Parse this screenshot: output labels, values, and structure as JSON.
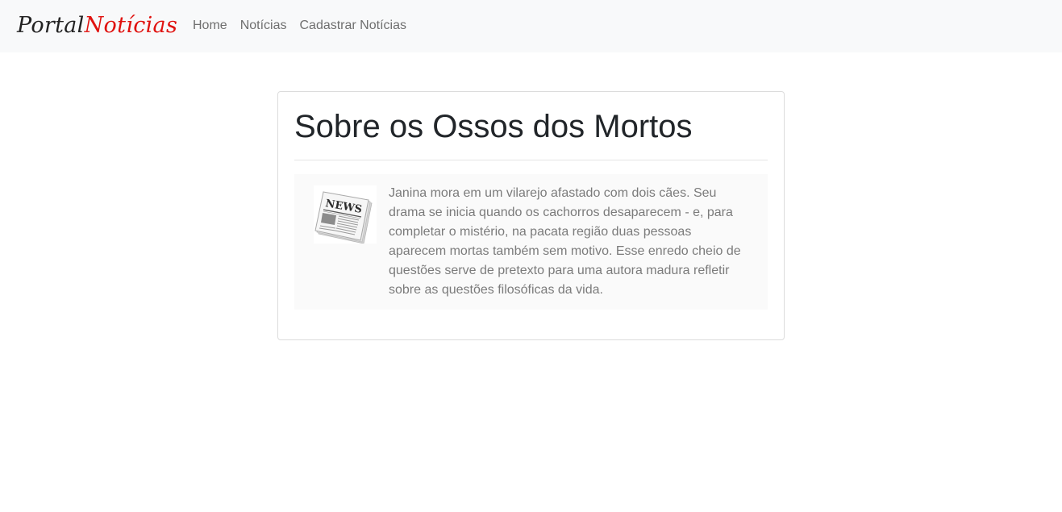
{
  "navbar": {
    "brand_part1": "Portal",
    "brand_part2": "Notícias",
    "links": [
      {
        "label": "Home"
      },
      {
        "label": "Notícias"
      },
      {
        "label": "Cadastrar Notícias"
      }
    ]
  },
  "article": {
    "title": "Sobre os Ossos dos Mortos",
    "image_icon": "newspaper-icon",
    "image_label": "NEWS",
    "excerpt": "Janina mora em um vilarejo afastado com dois cães. Seu drama se inicia quando os cachorros desaparecem - e, para completar o mistério, na pacata região duas pessoas aparecem mortas também sem motivo. Esse enredo cheio de questões serve de pretexto para uma autora madura refletir sobre as questões filosóficas da vida."
  },
  "colors": {
    "navbar_bg": "#f8f9fa",
    "brand_dark": "#222222",
    "brand_accent": "#e0120f",
    "nav_link": "#6f6f6f",
    "title_text": "#212529",
    "excerpt_text": "#7b7b7b"
  }
}
